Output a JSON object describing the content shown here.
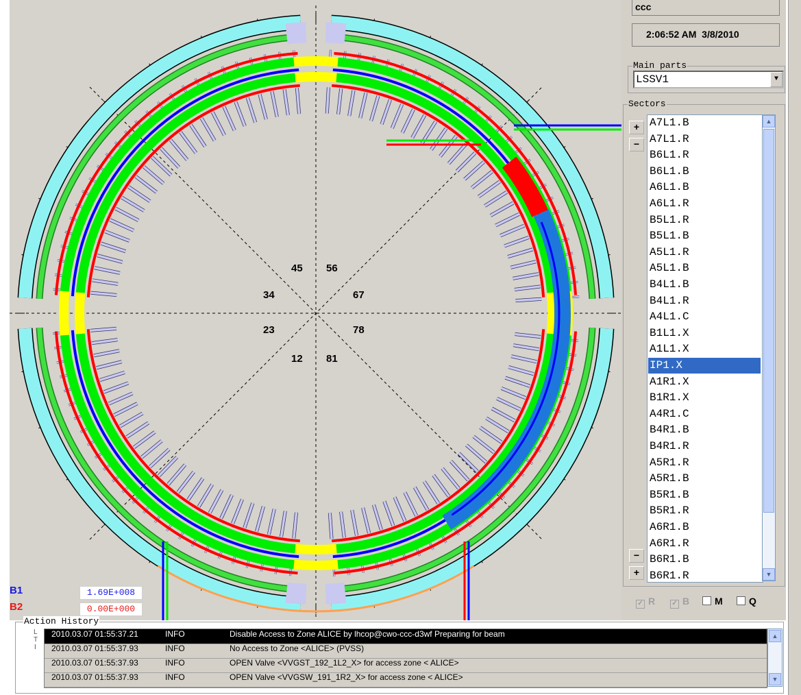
{
  "header": {
    "user": "ccc",
    "clock": "2:06:52 AM  3/8/2010"
  },
  "main_parts": {
    "label": "Main parts",
    "selected": "LSSV1"
  },
  "sectors": {
    "label": "Sectors",
    "items": [
      "A7L1.B",
      "A7L1.R",
      "B6L1.R",
      "B6L1.B",
      "A6L1.B",
      "A6L1.R",
      "B5L1.R",
      "B5L1.B",
      "A5L1.R",
      "A5L1.B",
      "B4L1.B",
      "B4L1.R",
      "A4L1.C",
      "B1L1.X",
      "A1L1.X",
      "IP1.X",
      "A1R1.X",
      "B1R1.X",
      "A4R1.C",
      "B4R1.B",
      "B4R1.R",
      "A5R1.R",
      "A5R1.B",
      "B5R1.B",
      "B5R1.R",
      "A6R1.B",
      "A6R1.R",
      "B6R1.B",
      "B6R1.R"
    ],
    "selected": "IP1.X"
  },
  "zoom_buttons": {
    "plus": "+",
    "minus": "−"
  },
  "checkboxes": [
    {
      "label": "R",
      "checked": true,
      "enabled": false
    },
    {
      "label": "B",
      "checked": true,
      "enabled": false
    },
    {
      "label": "M",
      "checked": false,
      "enabled": true
    },
    {
      "label": "Q",
      "checked": false,
      "enabled": true
    }
  ],
  "beams": [
    {
      "name": "B1",
      "value": "1.69E+008",
      "color": "#1a1ae6"
    },
    {
      "name": "B2",
      "value": "0.00E+000",
      "color": "#e61a1a"
    }
  ],
  "ring_labels": [
    "45",
    "56",
    "34",
    "67",
    "23",
    "78",
    "12",
    "81"
  ],
  "history": {
    "title": "Action History",
    "side_letters": [
      "L",
      "T",
      "I"
    ],
    "rows": [
      {
        "time": "2010.03.07 01:55:37.21",
        "level": "INFO",
        "message": "Disable Access to Zone ALICE by lhcop@cwo-ccc-d3wf Preparing for beam"
      },
      {
        "time": "2010.03.07 01:55:37.93",
        "level": "INFO",
        "message": "No Access to Zone <ALICE> (PVSS)"
      },
      {
        "time": "2010.03.07 01:55:37.93",
        "level": "INFO",
        "message": "OPEN Valve <VVGST_192_1L2_X> for access zone < ALICE>"
      },
      {
        "time": "2010.03.07 01:55:37.93",
        "level": "INFO",
        "message": "OPEN Valve <VVGSW_191_1R2_X> for access zone < ALICE>"
      }
    ]
  },
  "colors": {
    "beam_red": "#ff0000",
    "beam_blue": "#0000ff",
    "ok_green": "#00ee00",
    "yellow": "#ffff00",
    "cyan": "#8ff2f2",
    "lavender": "#c8c8f0",
    "status_blue": "#1e78dc",
    "orange": "#ffa050",
    "selection": "#316ac5"
  }
}
